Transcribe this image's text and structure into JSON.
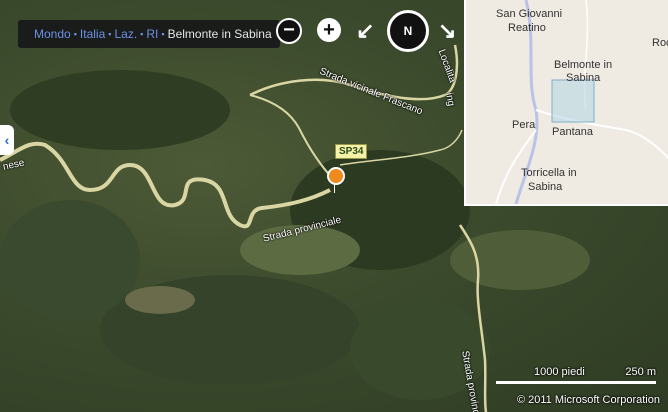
{
  "breadcrumb": {
    "links": [
      "Mondo",
      "Italia",
      "Laz.",
      "RI"
    ],
    "current": "Belmonte in Sabina"
  },
  "controls": {
    "zoom_out": "−",
    "zoom_in": "+",
    "rotate_left": "↙",
    "compass": "N",
    "rotate_right": "↘",
    "left_panel_toggle": "‹"
  },
  "road_labels": {
    "frascano": "Strada vicinale Frascano",
    "provinciale": "Strada provinciale",
    "provinciale_bottom": "Strada provinc",
    "locale": "Localita",
    "nese": "nese",
    "ing": "ing"
  },
  "marker_badge": "SP34",
  "overview": {
    "places": [
      "San Giovanni",
      "Reatino",
      "Belmonte in",
      "Sabina",
      "Pera",
      "Pantana",
      "Torricella in",
      "Sabina",
      "Roc"
    ]
  },
  "scale": {
    "imperial": "1000 piedi",
    "metric": "250 m"
  },
  "copyright": "© 2011 Microsoft Corporation",
  "colors": {
    "road": "#d9d6a3",
    "marker": "#f08a1e",
    "breadcrumb_link": "#6d8fe6"
  }
}
